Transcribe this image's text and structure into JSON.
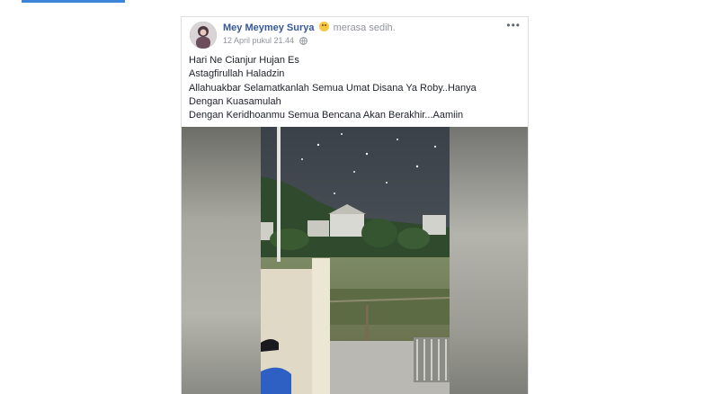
{
  "post": {
    "author": "Mey Meymey Surya",
    "feeling": "merasa sedih.",
    "feeling_icon": "sad-face-emoji",
    "timestamp": "12 April pukul 21.44",
    "privacy_icon": "globe-icon",
    "more_label": "•••",
    "lines": [
      "Hari Ne Cianjur Hujan Es",
      "Astagfirullah Haladzin",
      "Allahuakbar Selamatkanlah Semua Umat Disana Ya Roby..Hanya",
      "Dengan Kuasamulah",
      "Dengan Keridhoanmu Semua Bencana Akan Berakhir...Aamiin"
    ]
  },
  "colors": {
    "accent": "#3b84d8",
    "author_link": "#365899",
    "secondary_text": "#90949c"
  }
}
